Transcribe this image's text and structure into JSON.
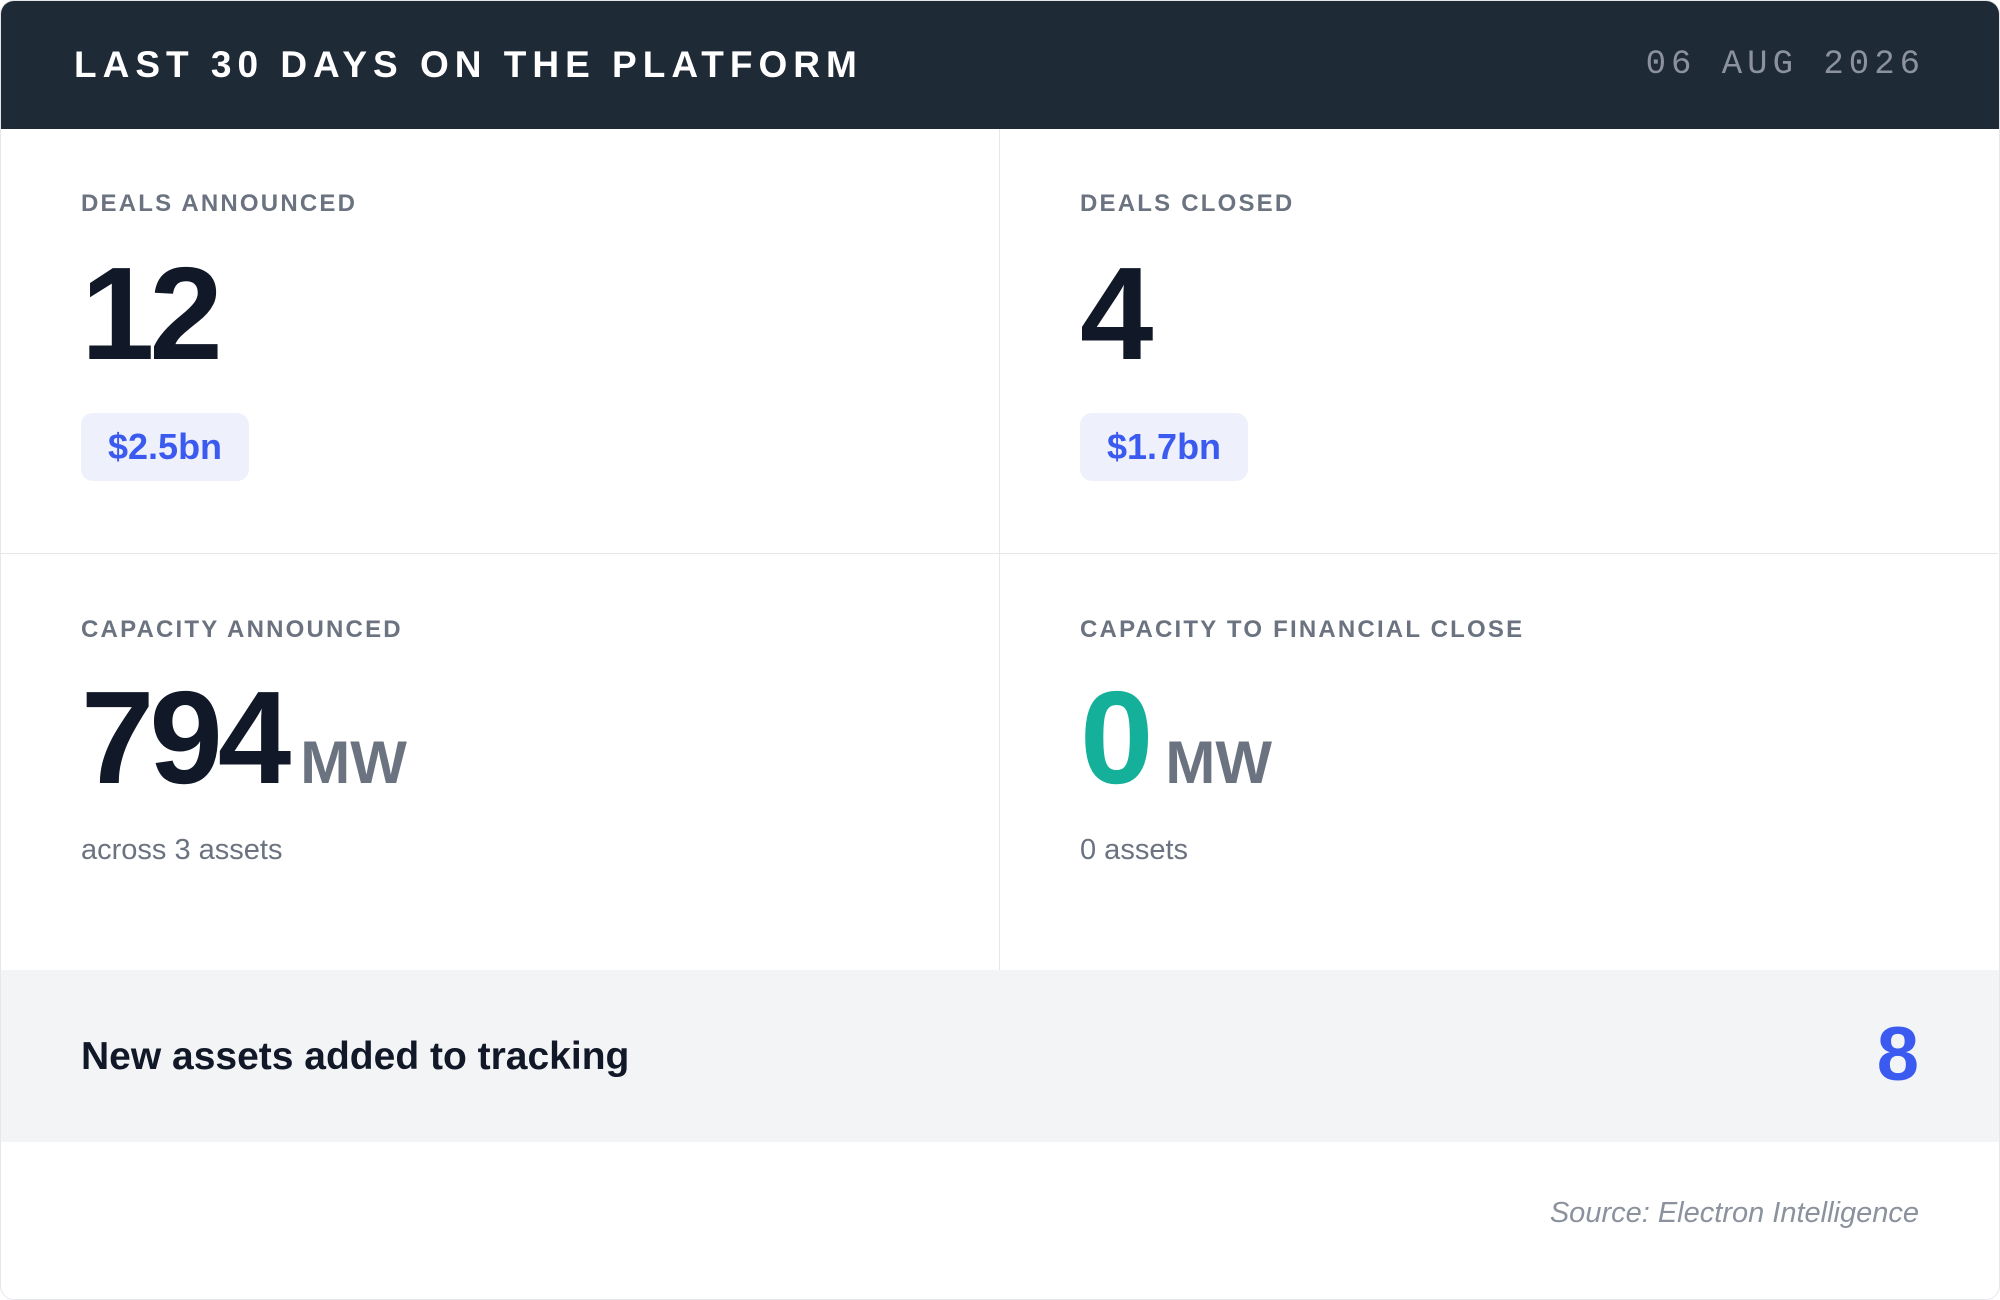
{
  "header": {
    "title": "LAST 30 DAYS ON THE PLATFORM",
    "date": "06 AUG 2026"
  },
  "metrics": [
    {
      "label": "DEALS ANNOUNCED",
      "value": "12",
      "badge": "$2.5bn"
    },
    {
      "label": "DEALS CLOSED",
      "value": "4",
      "badge": "$1.7bn"
    },
    {
      "label": "CAPACITY ANNOUNCED",
      "value": "794",
      "unit": "MW",
      "note": "across 3 assets"
    },
    {
      "label": "CAPACITY TO FINANCIAL CLOSE",
      "value": "0",
      "unit": "MW",
      "note": "0 assets"
    }
  ],
  "banner": {
    "label": "New assets added to tracking",
    "value": "8"
  },
  "footer": {
    "source": "Source: Electron Intelligence"
  },
  "colors": {
    "header_bg": "#1f2a37",
    "accent_blue": "#3b5bf0",
    "accent_teal": "#14b09a",
    "badge_bg": "#eef0fb",
    "banner_bg": "#f3f4f6"
  }
}
